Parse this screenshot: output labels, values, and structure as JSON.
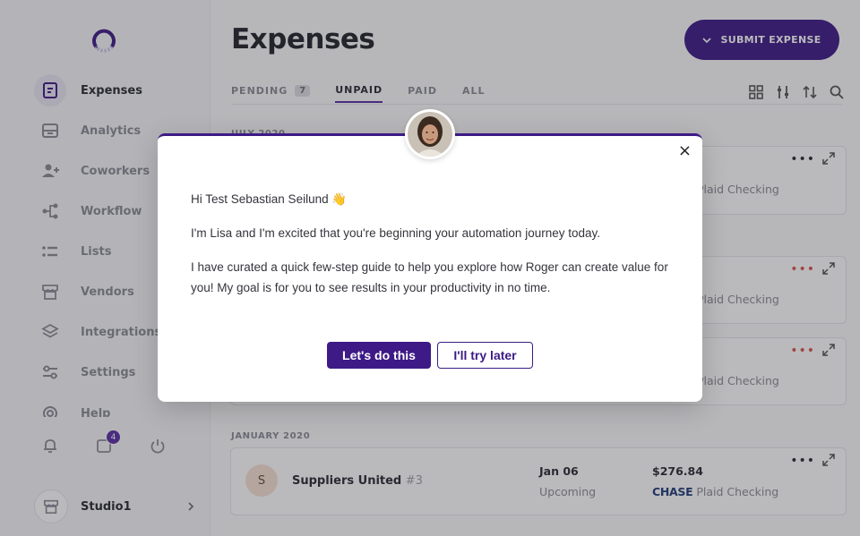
{
  "sidebar": {
    "logo_icon": "ring-logo-icon",
    "items": [
      {
        "label": "Expenses",
        "icon": "receipt-icon"
      },
      {
        "label": "Analytics",
        "icon": "analytics-icon"
      },
      {
        "label": "Coworkers",
        "icon": "add-user-icon"
      },
      {
        "label": "Workflow",
        "icon": "workflow-icon"
      },
      {
        "label": "Lists",
        "icon": "list-icon"
      },
      {
        "label": "Vendors",
        "icon": "store-icon"
      },
      {
        "label": "Integrations",
        "icon": "layers-icon"
      },
      {
        "label": "Settings",
        "icon": "sliders-icon"
      },
      {
        "label": "Help",
        "icon": "help-icon"
      }
    ],
    "inbox_count": "4",
    "org_name": "Studio1"
  },
  "header": {
    "title": "Expenses",
    "submit_label": "SUBMIT EXPENSE"
  },
  "tabs": [
    {
      "label": "PENDING",
      "count": "7"
    },
    {
      "label": "UNPAID",
      "count": ""
    },
    {
      "label": "PAID",
      "count": ""
    },
    {
      "label": "ALL",
      "count": ""
    }
  ],
  "sections": {
    "july": "JULY 2020",
    "january": "JANUARY 2020"
  },
  "cards": [
    {
      "bank": "Plaid Checking"
    },
    {
      "bank": "Plaid Checking"
    },
    {
      "bank": "Plaid Checking"
    }
  ],
  "expense": {
    "avatar_letter": "S",
    "vendor": "Suppliers United",
    "number": "#3",
    "date": "Jan 06",
    "status": "Upcoming",
    "amount": "$276.84",
    "bank_brand": "CHASE",
    "bank": "Plaid Checking"
  },
  "modal": {
    "greeting": "Hi Test Sebastian Seilund 👋",
    "line1": "I'm Lisa and I'm excited that you're beginning your automation journey today.",
    "line2": "I have curated a quick few-step guide to help you explore how Roger can create value for you! My goal is for you to see results in your productivity in no time.",
    "primary": "Let's do this",
    "secondary": "I'll try later",
    "close": "×"
  },
  "colors": {
    "brand": "#3d1a86",
    "accent": "#5b2ea6"
  }
}
